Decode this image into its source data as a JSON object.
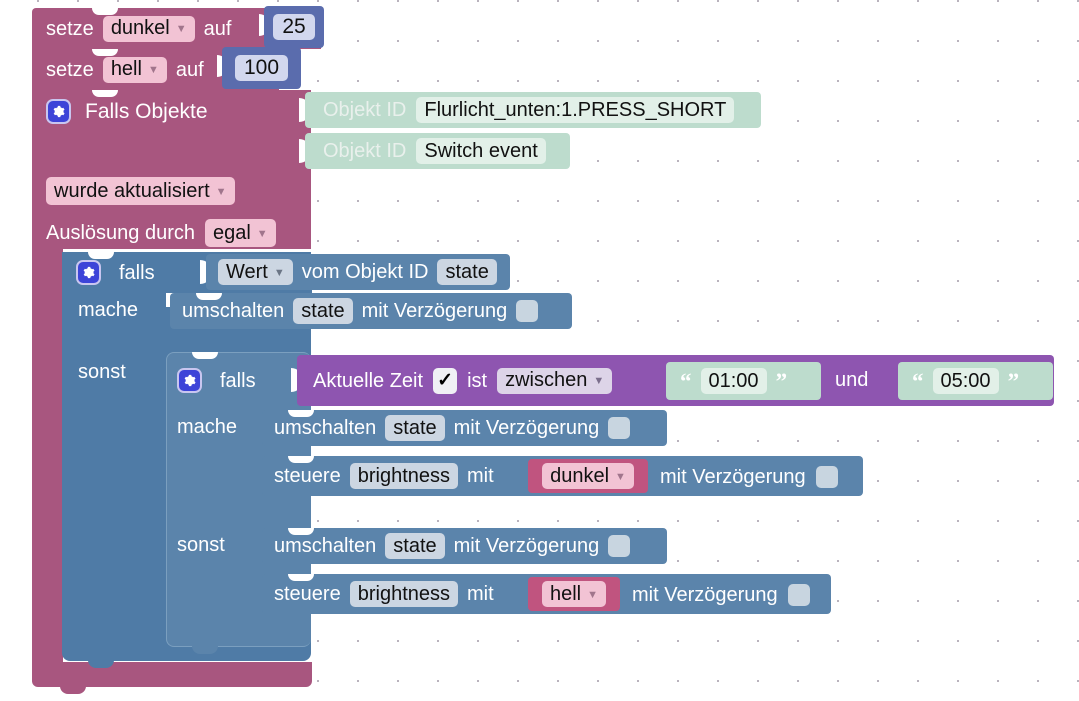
{
  "app": {
    "kind": "blockly-visual-script",
    "language": "de"
  },
  "colors": {
    "trigger_pink": "#a8567f",
    "control_blue": "#4f7ba6",
    "object_mint": "#bddccd",
    "time_purple": "#8e55b0",
    "number_slate": "#5a6cad",
    "variable_pink": "#c0547f",
    "canvas_bg": "#ffffff",
    "grid_dot": "#b9b3bd"
  },
  "blocks": {
    "set_dunkel": {
      "keyword": "setze",
      "variable": "dunkel",
      "connector": "auf",
      "value": "25"
    },
    "set_hell": {
      "keyword": "setze",
      "variable": "hell",
      "connector": "auf",
      "value": "100"
    },
    "trigger": {
      "title": "Falls Objekte",
      "object_id_label_1": "Objekt ID",
      "object_id_value_1": "Flurlicht_unten:1.PRESS_SHORT",
      "object_id_label_2": "Objekt ID",
      "object_id_value_2": "Switch event",
      "condition_dropdown": "wurde aktualisiert",
      "trigger_by_label": "Auslösung durch",
      "trigger_by_value": "egal"
    },
    "if_outer": {
      "if_label": "falls",
      "value_dropdown": "Wert",
      "from_object_label": "vom Objekt ID",
      "object_id": "state",
      "do_label": "mache",
      "else_label": "sonst",
      "do_statement": {
        "verb": "umschalten",
        "target": "state",
        "delay_label": "mit Verzögerung",
        "delay_checked": false
      }
    },
    "if_inner": {
      "if_label": "falls",
      "time_block": {
        "label": "Aktuelle Zeit",
        "checkbox": "✓",
        "is_label": "ist",
        "comparator": "zwischen",
        "from_value": "01:00",
        "and_label": "und",
        "to_value": "05:00",
        "quote_open": "“",
        "quote_close": "”"
      },
      "do_label": "mache",
      "else_label": "sonst",
      "do_statements": [
        {
          "verb": "umschalten",
          "target": "state",
          "delay_label": "mit Verzögerung",
          "delay_checked": false
        },
        {
          "verb": "steuere",
          "target": "brightness",
          "with_label": "mit",
          "value_variable": "dunkel",
          "delay_label": "mit Verzögerung",
          "delay_checked": false
        }
      ],
      "else_statements": [
        {
          "verb": "umschalten",
          "target": "state",
          "delay_label": "mit Verzögerung",
          "delay_checked": false
        },
        {
          "verb": "steuere",
          "target": "brightness",
          "with_label": "mit",
          "value_variable": "hell",
          "delay_label": "mit Verzögerung",
          "delay_checked": false
        }
      ]
    }
  },
  "icons": {
    "gear": "gear-icon",
    "dropdown_caret": "chevron-down-icon"
  }
}
